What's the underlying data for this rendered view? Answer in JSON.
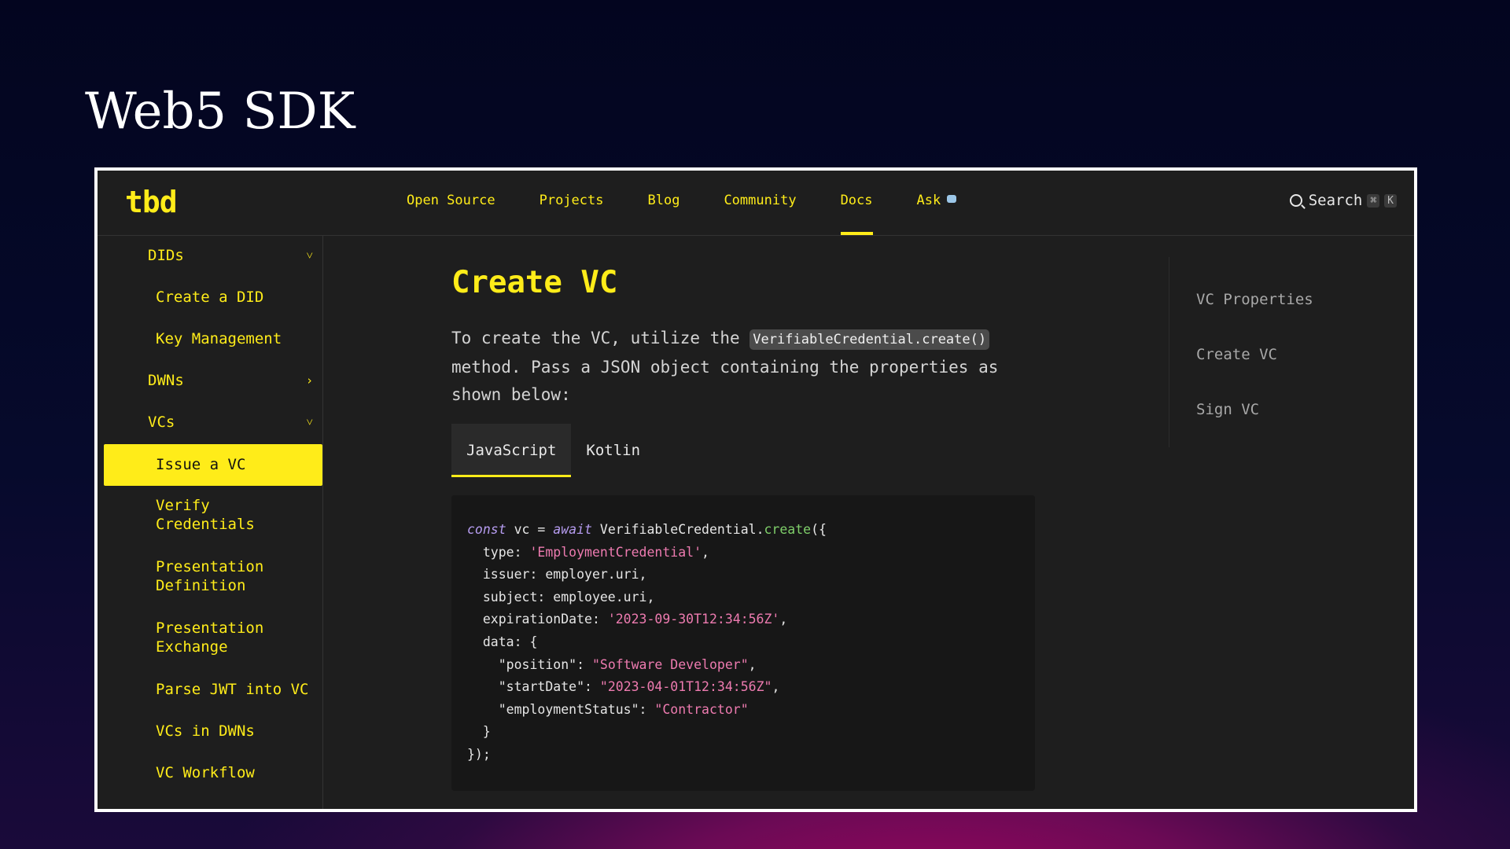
{
  "slide": {
    "title": "Web5 SDK"
  },
  "header": {
    "logo": "tbd",
    "nav": [
      {
        "label": "Open Source"
      },
      {
        "label": "Projects"
      },
      {
        "label": "Blog"
      },
      {
        "label": "Community"
      },
      {
        "label": "Docs",
        "active": true
      },
      {
        "label": "Ask"
      }
    ],
    "search_label": "Search",
    "shortcut_cmd": "⌘",
    "shortcut_key": "K"
  },
  "sidebar": {
    "items": [
      {
        "label": "DIDs",
        "chevron": "˅"
      },
      {
        "label": "Create a DID"
      },
      {
        "label": "Key Management"
      },
      {
        "label": "DWNs",
        "chevron": "›"
      },
      {
        "label": "VCs",
        "chevron": "˅"
      },
      {
        "label": "Issue a VC",
        "active": true
      },
      {
        "label": "Verify Credentials"
      },
      {
        "label": "Presentation Definition"
      },
      {
        "label": "Presentation Exchange"
      },
      {
        "label": "Parse JWT into VC"
      },
      {
        "label": "VCs in DWNs"
      },
      {
        "label": "VC Workflow"
      }
    ]
  },
  "main": {
    "title": "Create VC",
    "intro_before": "To create the VC, utilize the ",
    "intro_code": "VerifiableCredential.create()",
    "intro_after": " method. Pass a JSON object containing the properties as shown below:",
    "tabs": [
      {
        "label": "JavaScript",
        "active": true
      },
      {
        "label": "Kotlin"
      }
    ]
  },
  "code": {
    "kw_const": "const",
    "var_vc": " vc = ",
    "kw_await": "await",
    "obj": " VerifiableCredential.",
    "fn_create": "create",
    "open": "({",
    "type_key": "  type: ",
    "type_val": "'EmploymentCredential'",
    "issuer_line": "  issuer: employer.uri,",
    "subject_line": "  subject: employee.uri,",
    "exp_key": "  expirationDate: ",
    "exp_val": "'2023-09-30T12:34:56Z'",
    "data_line": "  data: {",
    "pos_key": "    \"position\": ",
    "pos_val": "\"Software Developer\"",
    "start_key": "    \"startDate\": ",
    "start_val": "\"2023-04-01T12:34:56Z\"",
    "emp_key": "    \"employmentStatus\": ",
    "emp_val": "\"Contractor\"",
    "close_data": "  }",
    "close_all": "});"
  },
  "toc": {
    "items": [
      {
        "label": "VC Properties"
      },
      {
        "label": "Create VC"
      },
      {
        "label": "Sign VC"
      }
    ]
  }
}
